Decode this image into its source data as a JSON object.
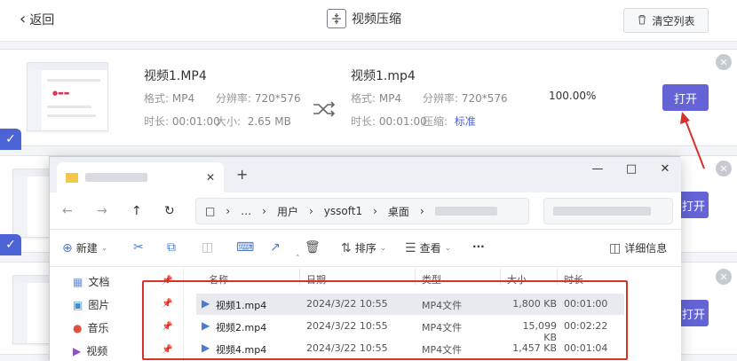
{
  "header": {
    "back_label": "返回",
    "title": "视频压缩",
    "clear_label": "清空列表"
  },
  "rows": [
    {
      "src_name": "视频1.MP4",
      "src_format_label": "格式:",
      "src_format": "MP4",
      "src_res_label": "分辨率:",
      "src_res": "720*576",
      "src_dur_label": "时长:",
      "src_dur": "00:01:00",
      "src_size_label": "大小:",
      "src_size": "2.65 MB",
      "out_name": "视频1.mp4",
      "out_format_label": "格式:",
      "out_format": "MP4",
      "out_res_label": "分辨率:",
      "out_res": "720*576",
      "out_dur_label": "时长:",
      "out_dur": "00:01:00",
      "out_comp_label": "压缩:",
      "out_comp": "标准",
      "progress": "100.00%",
      "open_label": "打开"
    }
  ],
  "row2_open_label": "打开",
  "row3_open_label": "打开",
  "explorer": {
    "new_tab": "+",
    "breadcrumb": [
      "…",
      "用户",
      "yssoft1",
      "桌面"
    ],
    "toolbar": {
      "new_label": "新建",
      "sort_label": "排序",
      "view_label": "查看",
      "more_label": "···",
      "details_label": "详细信息"
    },
    "sidebar": [
      {
        "label": "文档",
        "icon": "document-icon"
      },
      {
        "label": "图片",
        "icon": "picture-icon"
      },
      {
        "label": "音乐",
        "icon": "music-icon"
      },
      {
        "label": "视频",
        "icon": "video-icon"
      }
    ],
    "columns": [
      "名称",
      "日期",
      "类型",
      "大小",
      "时长"
    ],
    "files": [
      {
        "name": "视频1.mp4",
        "date": "2024/3/22 10:55",
        "type": "MP4文件",
        "size": "1,800 KB",
        "duration": "00:01:00"
      },
      {
        "name": "视频2.mp4",
        "date": "2024/3/22 10:55",
        "type": "MP4文件",
        "size": "15,099 KB",
        "duration": "00:02:22"
      },
      {
        "name": "视频4.mp4",
        "date": "2024/3/22 10:55",
        "type": "MP4文件",
        "size": "1,457 KB",
        "duration": "00:01:04"
      }
    ]
  },
  "colors": {
    "accent": "#6464d6",
    "check": "#4c63d6",
    "highlight": "#d9312b"
  }
}
